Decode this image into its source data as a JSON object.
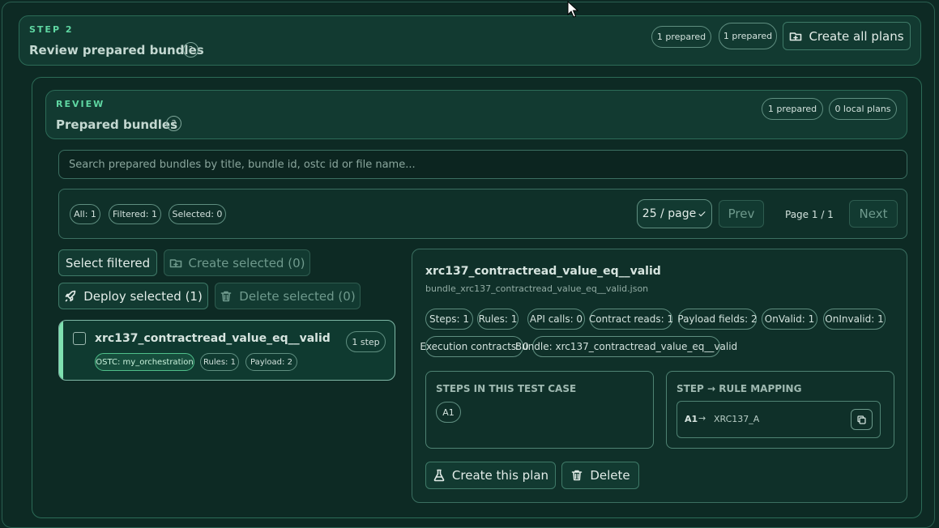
{
  "step": {
    "kicker": "STEP 2",
    "title": "Review prepared bundles",
    "help": "?",
    "badge1": "1 prepared",
    "badge2": "1 prepared",
    "create_all": "Create all plans"
  },
  "review": {
    "kicker": "REVIEW",
    "title": "Prepared bundles",
    "help": "?",
    "prepared": "1 prepared",
    "local": "0 local plans"
  },
  "search": {
    "placeholder": "Search prepared bundles by title, bundle id, ostc id or file name..."
  },
  "counts": {
    "all": "All: 1",
    "filtered": "Filtered: 1",
    "selected": "Selected: 0"
  },
  "paging": {
    "page_size": "25 / page",
    "prev": "Prev",
    "page_label": "Page 1 / 1",
    "next": "Next"
  },
  "actions": {
    "select_filtered": "Select filtered",
    "create_selected": "Create selected (0)",
    "deploy_selected": "Deploy selected (1)",
    "delete_selected": "Delete selected (0)"
  },
  "bundle": {
    "title": "xrc137_contractread_value_eq__valid",
    "steps": "1 step",
    "ostc": "OSTC: my_orchestration",
    "rules": "Rules: 1",
    "payload": "Payload: 2"
  },
  "detail": {
    "title": "xrc137_contractread_value_eq__valid",
    "file": "bundle_xrc137_contractread_value_eq__valid.json",
    "tags": [
      "Steps: 1",
      "Rules: 1",
      "API calls: 0",
      "Contract reads: 1",
      "Payload fields: 2",
      "OnValid: 1",
      "OnInvalid: 1",
      "Execution contracts: 0",
      "Bundle: xrc137_contractread_value_eq__valid"
    ],
    "steps_heading": "STEPS IN THIS TEST CASE",
    "step_chip": "A1",
    "mapping_heading": "STEP → RULE MAPPING",
    "map_step": "A1",
    "map_arrow": "→",
    "map_rule": "XRC137_A",
    "create_plan": "Create this plan",
    "delete": "Delete"
  },
  "colors": {
    "background": "#0d2a24",
    "accent": "#5fd7a2",
    "border": "#2c6b57",
    "selected_bar": "#7ee0b0"
  }
}
